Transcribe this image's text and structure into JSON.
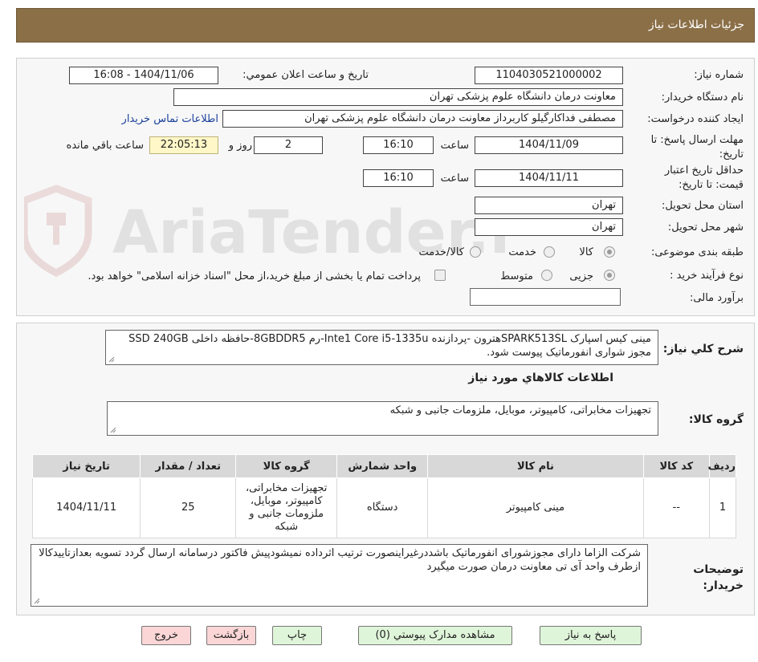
{
  "header": {
    "title": "جزئیات اطلاعات نیاز"
  },
  "form": {
    "need_number": {
      "label": "شماره نیاز:",
      "value": "1104030521000002"
    },
    "announce_date": {
      "label": "تاریخ و ساعت اعلان عمومي:",
      "value": "1404/11/06 - 16:08"
    },
    "buyer_org": {
      "label": "نام دستگاه خریدار:",
      "value": "معاونت درمان دانشگاه علوم پزشکی تهران"
    },
    "requester": {
      "label": "ایجاد کننده درخواست:",
      "value": "مصطفی فداکارگیلو کاربرداز  معاونت درمان دانشگاه علوم پزشکی تهران",
      "contact_link": "اطلاعات تماس خریدار"
    },
    "reply_deadline": {
      "label_line1": "مهلت ارسال پاسخ: تا",
      "label_line2": "تاریخ:",
      "date": "1404/11/09",
      "time_label": "ساعت",
      "time": "16:10",
      "days": "2",
      "days_label": "روز و",
      "remaining": "22:05:13",
      "remaining_label": "ساعت باقي مانده"
    },
    "price_validity": {
      "label_line1": "حداقل تاریخ اعتبار",
      "label_line2": "قیمت: تا تاریخ:",
      "date": "1404/11/11",
      "time_label": "ساعت",
      "time": "16:10"
    },
    "delivery_province": {
      "label": "استان محل تحویل:",
      "value": "تهران"
    },
    "delivery_city": {
      "label": "شهر محل تحویل:",
      "value": "تهران"
    },
    "category": {
      "label": "طبقه بندی موضوعی:",
      "options": [
        "کالا",
        "خدمت",
        "کالا/خدمت"
      ],
      "selected": "کالا"
    },
    "purchase_type": {
      "label": "نوع فرآیند خرید :",
      "options": [
        "جزیی",
        "متوسط"
      ],
      "note": "پرداخت تمام یا بخشی از مبلغ خرید،از محل \"اسناد خزانه اسلامی\" خواهد بود."
    },
    "budget": {
      "label": "برآورد مالی:",
      "value": ""
    }
  },
  "summary": {
    "label": "شرح کلي نیاز:",
    "text": "مینی کیس اسپارک SPARK513SLهترون -پردازنده Inte1 Core i5-1335u-رم 8GBDDR5-حافظه داخلی SSD 240GB مجوز شواری انفورماتیک پیوست شود."
  },
  "goods_section": {
    "title": "اطلاعات کالاهاي مورد نیاز",
    "group_label": "گروه کالا:",
    "group_value": "تجهیزات مخابراتی، کامپیوتر، موبایل، ملزومات جانبی و شبکه"
  },
  "items_table": {
    "columns": [
      "ردیف",
      "کد کالا",
      "نام کالا",
      "واحد شمارش",
      "گروه کالا",
      "تعداد / مقدار",
      "تاریخ نیاز"
    ],
    "rows": [
      {
        "row": "1",
        "code": "--",
        "name": "مینی کامپیوتر",
        "unit": "دستگاه",
        "group": "تجهیزات مخابراتی، کامپیوتر، موبایل، ملزومات جانبی و شبکه",
        "qty": "25",
        "date": "1404/11/11"
      }
    ]
  },
  "buyer_notes": {
    "label_line1": "توضیحات",
    "label_line2": "خریدار:",
    "text": "شرکت الزاما دارای مجوزشورای انفورماتیک باشددرغیراینصورت ترتیب اثرداده نمیشودپیش فاکتور درسامانه ارسال گردد تسویه بعدازتاییدکالا ازطرف واحد آی تی معاونت درمان صورت میگیرد"
  },
  "buttons": {
    "reply": "پاسخ به نیاز",
    "attachments": "مشاهده مدارک پیوستي (0)",
    "print": "چاپ",
    "back": "بازگشت",
    "exit": "خروج"
  },
  "watermark": {
    "text": "AriaTender.neT"
  },
  "colors": {
    "header_bg": "#8b6f47",
    "remaining_bg": "#fff7c7",
    "link": "#1a3f9c",
    "button_green": "#dff5d9",
    "button_red": "#fbd6d6"
  }
}
